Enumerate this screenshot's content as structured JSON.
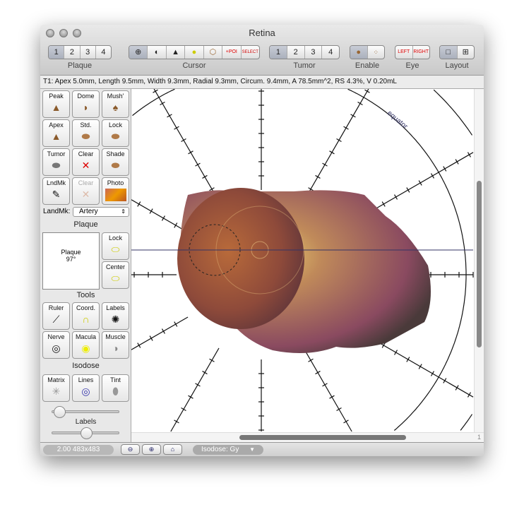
{
  "window": {
    "title": "Retina"
  },
  "toolbar": {
    "plaque": {
      "label": "Plaque",
      "items": [
        "1",
        "2",
        "3",
        "4"
      ],
      "selected": "1"
    },
    "cursor": {
      "label": "Cursor",
      "items": [
        "move-plaque",
        "rotate",
        "arrow",
        "yellow-target",
        "ring",
        "POI",
        "SELECT"
      ]
    },
    "tumor": {
      "label": "Tumor",
      "items": [
        "1",
        "2",
        "3",
        "4"
      ],
      "selected": "1"
    },
    "enable": {
      "label": "Enable",
      "items": [
        "single",
        "multi"
      ]
    },
    "eye": {
      "label": "Eye",
      "items": [
        "LEFT",
        "RIGHT"
      ]
    },
    "layout": {
      "label": "Layout",
      "items": [
        "single",
        "quad"
      ]
    }
  },
  "status": "T1: Apex 5.0mm, Length 9.5mm, Width 9.3mm, Radial 9.3mm, Circum. 9.4mm, A 78.5mm^2, RS 4.3%, V 0.20mL",
  "sidebar": {
    "shapes": [
      "Peak",
      "Dome",
      "Mush'",
      "Apex",
      "Std.",
      "Lock",
      "Tumor",
      "Clear",
      "Shade",
      "LndMk",
      "Clear",
      "Photo"
    ],
    "landmark_label": "LandMk:",
    "landmark_value": "Artery",
    "plaque_title": "Plaque",
    "plaque_name": "Plaque",
    "plaque_angle": "97°",
    "plaque_buttons": [
      "Lock",
      "Center"
    ],
    "tools_title": "Tools",
    "tools": [
      "Ruler",
      "Coord.",
      "Labels",
      "Nerve",
      "Macula",
      "Muscle"
    ],
    "isodose_title": "Isodose",
    "isodose": [
      "Matrix",
      "Lines",
      "Tint"
    ],
    "labels_slider": "Labels"
  },
  "canvas": {
    "equator_label": "equator",
    "page": "1"
  },
  "bottom": {
    "zoom": "2.00 483x483",
    "isodose": "Isodose: Gy"
  }
}
